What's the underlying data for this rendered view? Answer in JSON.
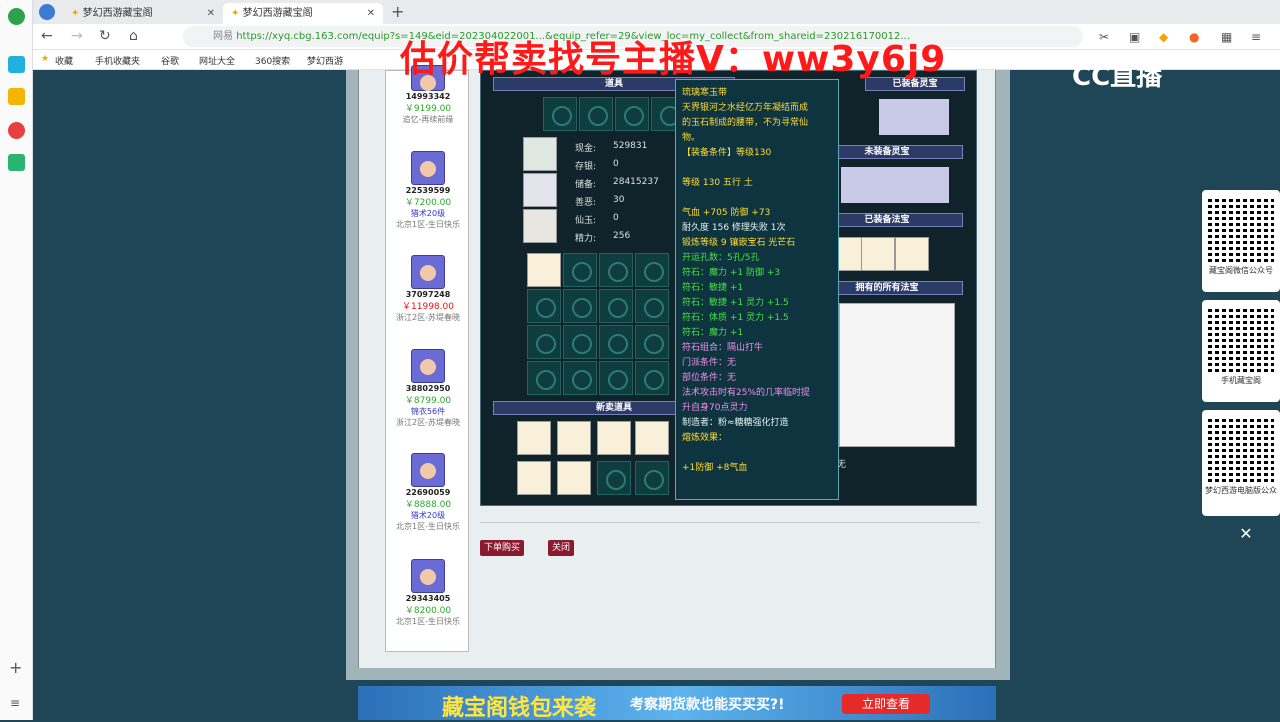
{
  "browser": {
    "tab1": "梦幻西游藏宝阁",
    "tab2": "梦幻西游藏宝阁",
    "url_host": "网易",
    "url": "https://xyq.cbg.163.com/equip?s=149&eid=202304022001...&equip_refer=29&view_loc=my_collect&from_shareid=230216170012...",
    "bookmarks": [
      "收藏",
      "手机收藏夹",
      "谷歌",
      "网址大全",
      "360搜索",
      "梦幻西游"
    ]
  },
  "overlay": {
    "promo": "估价帮卖找号主播V：ww3y6j9",
    "logo": "CC直播"
  },
  "listings": [
    {
      "id": "14993342",
      "price": "￥9199.00",
      "tag": "",
      "server": "追忆-再续前缘",
      "red": false
    },
    {
      "id": "22539599",
      "price": "￥7200.00",
      "tag": "猎术20级",
      "server": "北京1区-生日快乐",
      "red": false
    },
    {
      "id": "37097248",
      "price": "￥11998.00",
      "tag": "",
      "server": "浙江2区-苏堤春晓",
      "red": true
    },
    {
      "id": "38802950",
      "price": "￥8799.00",
      "tag": "锦衣56件",
      "server": "浙江2区-苏堤春晓",
      "red": false
    },
    {
      "id": "22690059",
      "price": "￥8888.00",
      "tag": "猎术20级",
      "server": "北京1区-生日快乐",
      "red": false
    },
    {
      "id": "29343405",
      "price": "￥8200.00",
      "tag": "",
      "server": "北京1区-生日快乐",
      "red": false
    }
  ],
  "panel": {
    "hdr_items": "道具",
    "hdr_equipped_spirit": "已装备灵宝",
    "hdr_unequipped_spirit": "未装备灵宝",
    "hdr_equipped_magic": "已装备法宝",
    "hdr_all_magic": "拥有的所有法宝",
    "hdr_newitems": "新卖道具",
    "stats": [
      {
        "label": "现金:",
        "value": "529831"
      },
      {
        "label": "存银:",
        "value": "0"
      },
      {
        "label": "储备:",
        "value": "28415237"
      },
      {
        "label": "善恶:",
        "value": "30"
      },
      {
        "label": "仙玉:",
        "value": "0"
      },
      {
        "label": "精力:",
        "value": "256"
      }
    ],
    "none": "无"
  },
  "tooltip": {
    "name": "琉璃寒玉带",
    "desc1": "天界银河之水经亿万年凝结而成",
    "desc2": "的玉石制成的腰带，不为寻常仙",
    "desc3": "物。",
    "req": "【装备条件】等级130",
    "level": "等级 130  五行 土",
    "hp": "气血 +705 防御 +73",
    "dur": "耐久度 156  修理失败 1次",
    "forge": "锻炼等级 9  镶嵌宝石 光芒石",
    "holes": "开运孔数：5孔/5孔",
    "r1": "符石：魔力 +1 防御 +3",
    "r2": "符石：敏捷 +1",
    "r3": "符石：敏捷 +1 灵力 +1.5",
    "r4": "符石：体质 +1 灵力 +1.5",
    "r5": "符石：魔力 +1",
    "combo": "符石组合：隔山打牛",
    "sect": "门派条件：无",
    "part": "部位条件：无",
    "skill1": "法术攻击时有25%的几率临时提",
    "skill2": "升自身70点灵力",
    "maker": "制造者：粉≈糖糖强化打造",
    "melt": "熔炼效果：",
    "bonus": "+1防御 +8气血"
  },
  "buttons": {
    "buy": "下单购买",
    "close": "关闭"
  },
  "ad": {
    "t1": "藏宝阁钱包来袭",
    "t2": "考察期货款也能买买买?!",
    "btn": "立即查看"
  },
  "qrs": [
    "藏宝阁微信公众号",
    "手机藏宝阁",
    "梦幻西游电脑版公众"
  ]
}
